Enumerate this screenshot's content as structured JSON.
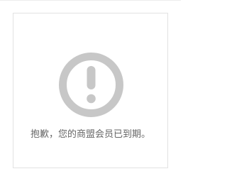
{
  "notice": {
    "icon": "exclamation-circle-icon",
    "icon_color": "#c7c7c7",
    "message": "抱歉，您的商盟会员已到期。",
    "text_color": "#666666",
    "border_color": "#e2e2e2"
  }
}
